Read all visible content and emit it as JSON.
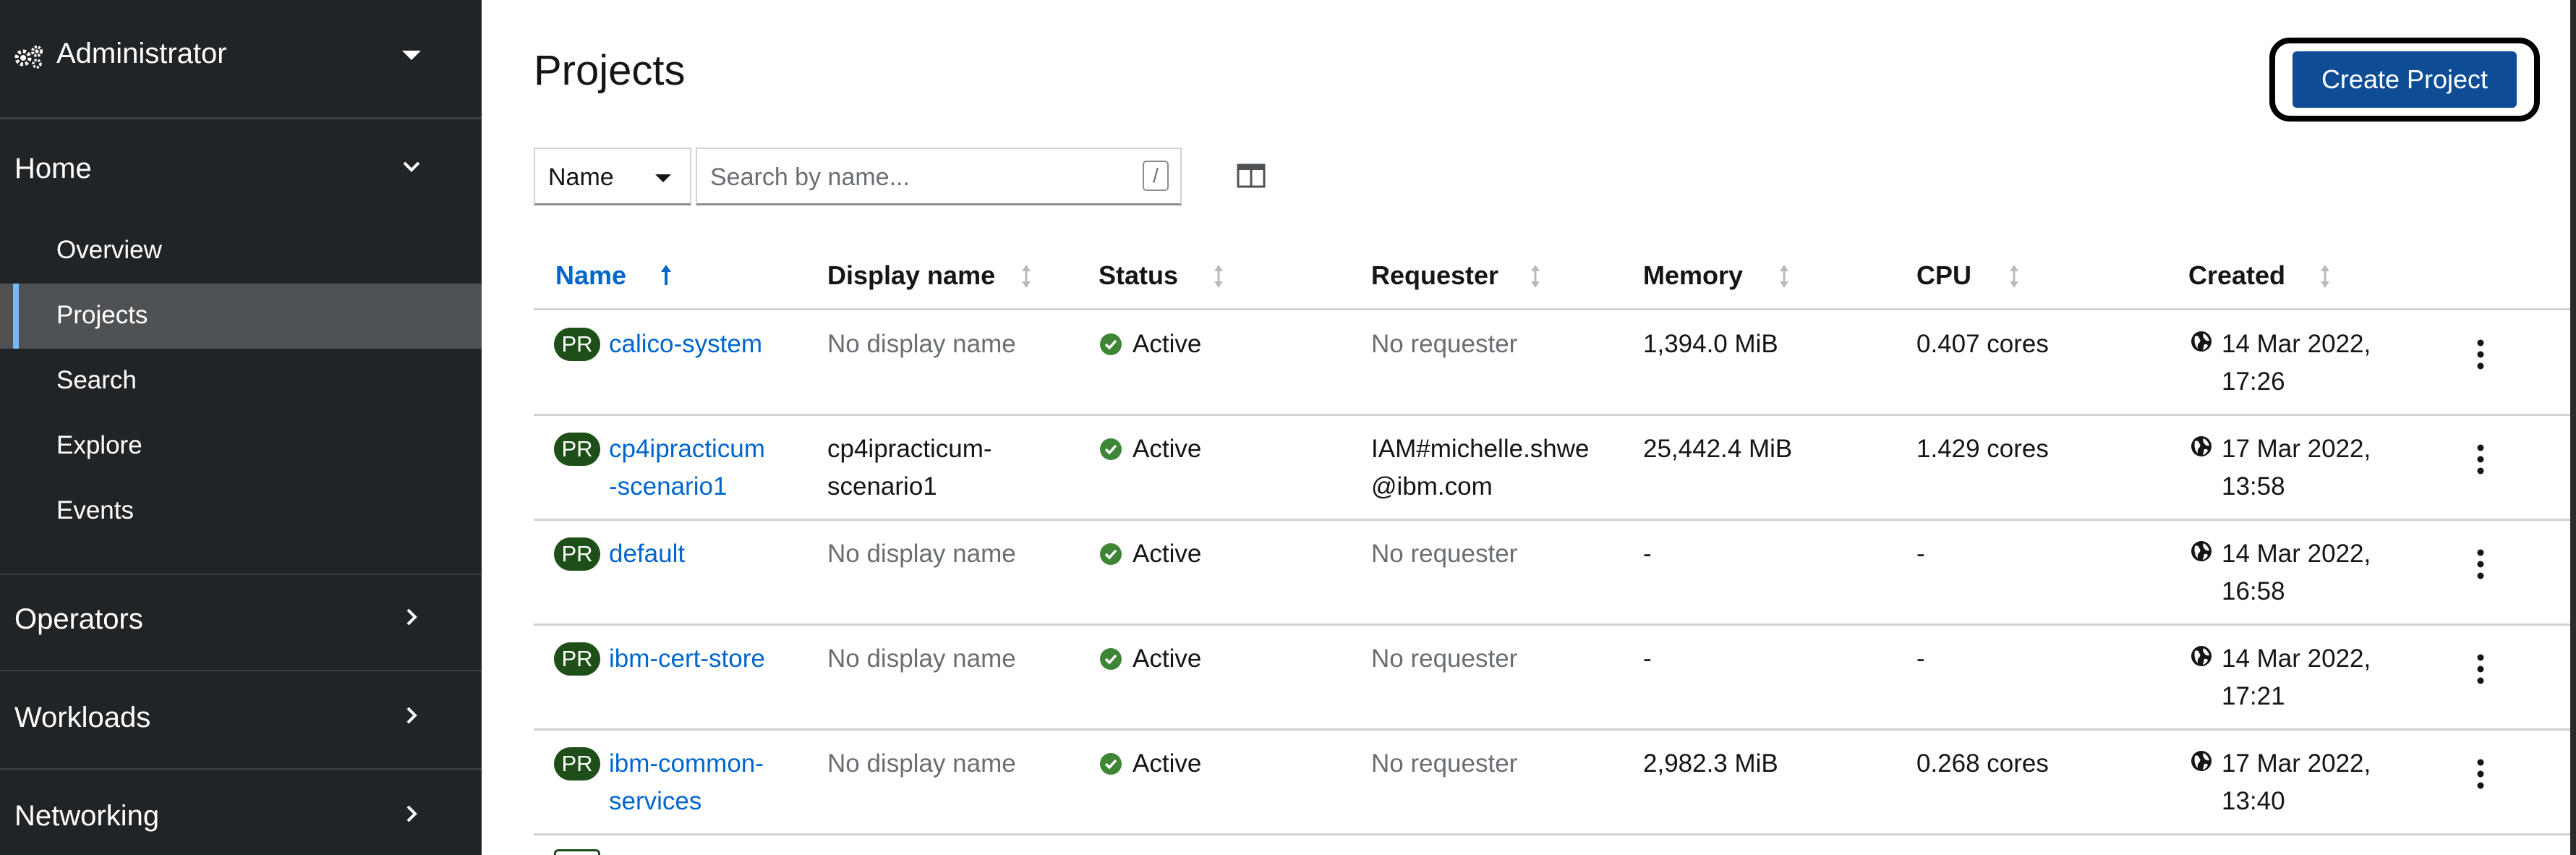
{
  "sidebar": {
    "perspective": {
      "label": "Administrator"
    },
    "sections": [
      {
        "label": "Home",
        "expanded": true,
        "items": [
          {
            "label": "Overview",
            "active": false
          },
          {
            "label": "Projects",
            "active": true
          },
          {
            "label": "Search",
            "active": false
          },
          {
            "label": "Explore",
            "active": false
          },
          {
            "label": "Events",
            "active": false
          }
        ]
      },
      {
        "label": "Operators",
        "expanded": false
      },
      {
        "label": "Workloads",
        "expanded": false
      },
      {
        "label": "Networking",
        "expanded": false
      }
    ]
  },
  "header": {
    "title": "Projects",
    "create_button": "Create Project"
  },
  "filter": {
    "type_label": "Name",
    "search_placeholder": "Search by name...",
    "shortcut_key": "/"
  },
  "table": {
    "columns": [
      "Name",
      "Display name",
      "Status",
      "Requester",
      "Memory",
      "CPU",
      "Created"
    ],
    "sorted_column": "Name",
    "sort_direction": "ascending",
    "rows": [
      {
        "badge": "PR",
        "name_l1": "calico-system",
        "name_l2": "",
        "display_l1": "No display name",
        "display_l2": "",
        "status": "Active",
        "requester_l1": "No requester",
        "requester_l2": "",
        "memory": "1,394.0 MiB",
        "cpu": "0.407 cores",
        "created_l1": "14 Mar 2022,",
        "created_l2": "17:26"
      },
      {
        "badge": "PR",
        "name_l1": "cp4ipracticum",
        "name_l2": "-scenario1",
        "display_l1": "cp4ipracticum-",
        "display_l2": "scenario1",
        "status": "Active",
        "requester_l1": "IAM#michelle.shwe",
        "requester_l2": "@ibm.com",
        "memory": "25,442.4 MiB",
        "cpu": "1.429 cores",
        "created_l1": "17 Mar 2022,",
        "created_l2": "13:58"
      },
      {
        "badge": "PR",
        "name_l1": "default",
        "name_l2": "",
        "display_l1": "No display name",
        "display_l2": "",
        "status": "Active",
        "requester_l1": "No requester",
        "requester_l2": "",
        "memory": "-",
        "cpu": "-",
        "created_l1": "14 Mar 2022,",
        "created_l2": "16:58"
      },
      {
        "badge": "PR",
        "name_l1": "ibm-cert-store",
        "name_l2": "",
        "display_l1": "No display name",
        "display_l2": "",
        "status": "Active",
        "requester_l1": "No requester",
        "requester_l2": "",
        "memory": "-",
        "cpu": "-",
        "created_l1": "14 Mar 2022,",
        "created_l2": "17:21"
      },
      {
        "badge": "PR",
        "name_l1": "ibm-common-",
        "name_l2": "services",
        "display_l1": "No display name",
        "display_l2": "",
        "status": "Active",
        "requester_l1": "No requester",
        "requester_l2": "",
        "memory": "2,982.3 MiB",
        "cpu": "0.268 cores",
        "created_l1": "17 Mar 2022,",
        "created_l2": "13:40"
      }
    ]
  },
  "colors": {
    "sidebar_bg": "#212427",
    "active_item_bg": "#4f5255",
    "primary_button": "#0f4c96",
    "link": "#0066cc",
    "status_active": "#3e8635",
    "project_badge": "#1e4f18"
  },
  "icons": {
    "perspective": "gears-icon",
    "status": "check-circle-icon",
    "created": "globe-icon",
    "row_actions": "kebab-icon",
    "columns": "column-management-icon"
  }
}
